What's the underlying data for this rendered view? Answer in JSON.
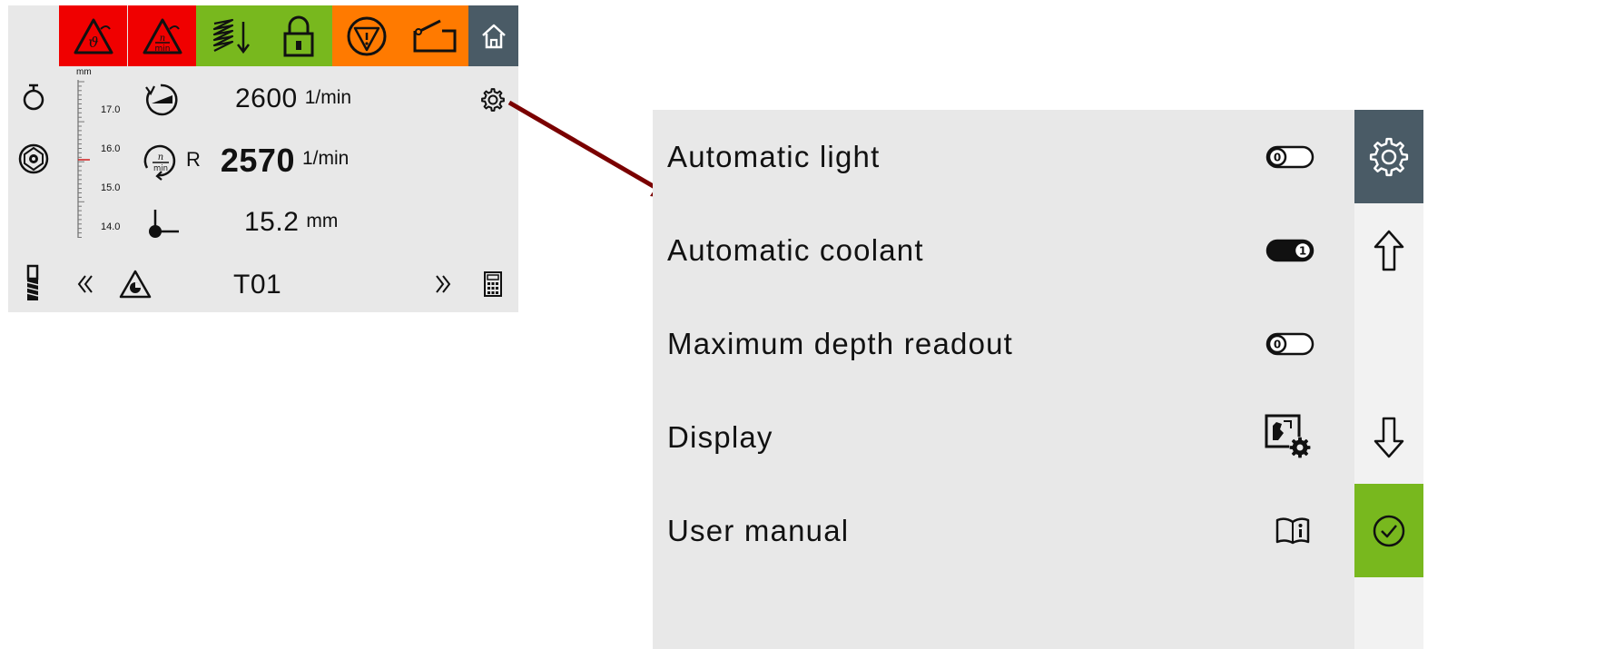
{
  "machine_panel": {
    "toolbar": [
      {
        "name": "temperature-warning",
        "color": "#f00000"
      },
      {
        "name": "speed-warning",
        "color": "#f00000"
      },
      {
        "name": "feed-down",
        "color": "#78b81e"
      },
      {
        "name": "lock",
        "color": "#78b81e"
      },
      {
        "name": "emergency-stop",
        "color": "#ff7a00"
      },
      {
        "name": "guard-open",
        "color": "#ff7a00"
      },
      {
        "name": "home",
        "color": "#4a5b66"
      }
    ],
    "scale": {
      "unit": "mm",
      "labels": [
        "17.0",
        "16.0",
        "15.0",
        "14.0"
      ],
      "marker_color": "#d02020"
    },
    "readouts": {
      "set_speed": {
        "value": "2600",
        "unit": "1/min"
      },
      "actual_speed": {
        "prefix": "R",
        "value": "2570",
        "unit": "1/min"
      },
      "depth": {
        "value": "15.2",
        "unit": "mm"
      }
    },
    "tool": {
      "label": "T01"
    }
  },
  "settings": {
    "items": [
      {
        "label": "Automatic light",
        "control": "toggle",
        "state": "0"
      },
      {
        "label": "Automatic coolant",
        "control": "toggle",
        "state": "1"
      },
      {
        "label": "Maximum depth readout",
        "control": "toggle",
        "state": "0"
      },
      {
        "label": "Display",
        "control": "display-settings-icon"
      },
      {
        "label": "User manual",
        "control": "book-info-icon"
      }
    ],
    "sidebar": {
      "settings_color": "#4a5b66",
      "confirm_color": "#78b81e"
    }
  },
  "arrow_color": "#7a0000"
}
